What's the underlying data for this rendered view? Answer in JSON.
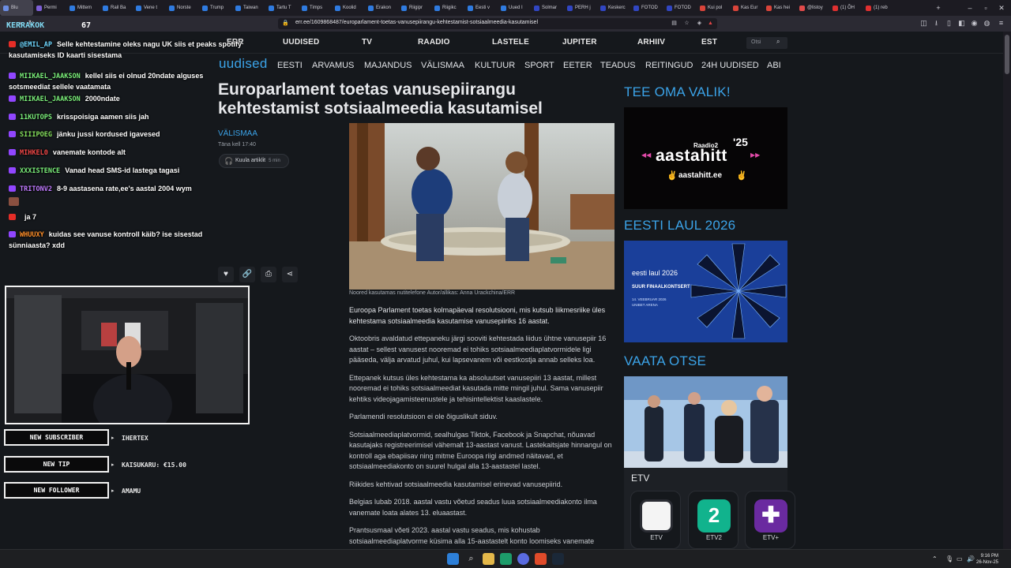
{
  "browser": {
    "tabs": [
      {
        "label": "Blu",
        "color": "#6b8de3",
        "active": true
      },
      {
        "label": "Permi",
        "color": "#7d5fd6"
      },
      {
        "label": "Mittem",
        "color": "#2f7be0"
      },
      {
        "label": "Rail Ba",
        "color": "#2f7be0"
      },
      {
        "label": "Vene t",
        "color": "#2f7be0"
      },
      {
        "label": "Norste",
        "color": "#2f7be0"
      },
      {
        "label": "Trump",
        "color": "#2f7be0"
      },
      {
        "label": "Taiwan",
        "color": "#2f7be0"
      },
      {
        "label": "Tartu T",
        "color": "#2f7be0"
      },
      {
        "label": "Timps",
        "color": "#2f7be0"
      },
      {
        "label": "Koolid",
        "color": "#2f7be0"
      },
      {
        "label": "Erakon",
        "color": "#2f7be0"
      },
      {
        "label": "Riigipr",
        "color": "#2f7be0"
      },
      {
        "label": "Riigikc",
        "color": "#2f7be0"
      },
      {
        "label": "Eesti v",
        "color": "#2f7be0"
      },
      {
        "label": "Uued I",
        "color": "#2f7be0"
      },
      {
        "label": "Solmar",
        "color": "#3146c2"
      },
      {
        "label": "PERH j",
        "color": "#3146c2"
      },
      {
        "label": "Keskerc",
        "color": "#3146c2"
      },
      {
        "label": "FOTOD",
        "color": "#3146c2"
      },
      {
        "label": "FOTOD",
        "color": "#3146c2"
      },
      {
        "label": "Kui pol",
        "color": "#d9443a"
      },
      {
        "label": "Kas Eur",
        "color": "#d9443a"
      },
      {
        "label": "Kas hei",
        "color": "#d9443a"
      },
      {
        "label": "@listoy",
        "color": "#e04a4a"
      },
      {
        "label": "(1) ÕH",
        "color": "#e03030"
      },
      {
        "label": "(1) reb",
        "color": "#e03030"
      }
    ],
    "url": "err.ee/1609868487/europarlament-toetas-vanusepiirangu-kehtestamist-sotsiaalmeedia-kasutamisel"
  },
  "site": {
    "top_nav": [
      "ERR",
      "UUDISED",
      "TV",
      "RAADIO",
      "LASTELE",
      "JUPITER",
      "ARHIIV",
      "EST"
    ],
    "search_placeholder": "Otsi",
    "logo": "uudised",
    "sections": [
      "EESTI",
      "ARVAMUS",
      "MAJANDUS",
      "VÄLISMAA",
      "KULTUUR",
      "SPORT",
      "EETER",
      "TEADUS",
      "REITINGUD",
      "24H UUDISED",
      "ABI"
    ]
  },
  "article": {
    "headline": "Europarlament toetas vanusepiirangu kehtestamist sotsiaalmeedia kasutamisel",
    "category": "VÄLISMAA",
    "time": "Täna kell 17:40",
    "listen_label": "Kuula artiklit",
    "listen_duration": "5 min",
    "caption": "Noored kasutamas nutitelefone Autor/allikas: Anna Urackchina/ERR",
    "paragraphs": [
      "Euroopa Parlament toetas kolmapäeval resolutsiooni, mis kutsub liikmesriike üles kehtestama sotsiaalmeedia kasutamise vanusepiiriks 16 aastat.",
      "Oktoobris avaldatud ettepaneku järgi sooviti kehtestada liidus ühtne vanusepiir 16 aastat – sellest vanusest nooremad ei tohiks sotsiaalmeediaplatvormidele ligi pääseda, välja arvatud juhul, kui lapsevanem või eestkostja annab selleks loa.",
      "Ettepanek kutsus üles kehtestama ka absoluutset vanusepiiri 13 aastat, millest nooremad ei tohiks sotsiaalmeediat kasutada mitte mingil juhul. Sama vanusepiir kehtiks videojagamisteenustele ja tehisintellektist kaaslastele.",
      "Parlamendi resolutsioon ei ole õiguslikult siduv.",
      "Sotsiaalmeediaplatvormid, sealhulgas Tiktok, Facebook ja Snapchat, nõuavad kasutajaks registreerimisel vähemalt 13-aastast vanust. Lastekaitsjate hinnangul on kontroll aga ebapiisav ning mitme Euroopa riigi andmed näitavad, et sotsiaalmeediakonto on suurel hulgal alla 13-aastastel lastel.",
      "Riikides kehtivad sotsiaalmeedia kasutamisel erinevad vanusepiirid.",
      "Belgias lubab 2018. aastal vastu võetud seadus luua sotsiaalmeediakonto ilma vanemate loata alates 13. eluaastast.",
      "Prantsusmaal võeti 2023. aastal vastu seadus, mis kohustab sotsiaalmeediaplatvorme küsima alla 15-aastastelt konto loomiseks vanemate"
    ]
  },
  "sidebar": {
    "tee_title": "TEE OMA VALIK!",
    "aastahitt_brand": "Raadio2",
    "aastahitt_title": "aastahitt",
    "aastahitt_year": "'25",
    "aastahitt_url": "aastahitt.ee",
    "eesti_laul_title": "EESTI LAUL 2026",
    "eesti_laul_logo": "eesti laul 2026",
    "eesti_laul_event": "SUUR FINAALKONTSERT",
    "eesti_laul_date": "14. VEEBRUAR 2026",
    "eesti_laul_venue": "UNIBET ARENA",
    "vaata_title": "VAATA OTSE",
    "etv_label": "ETV",
    "channels": [
      "ETV",
      "ETV2",
      "ETV+"
    ]
  },
  "overlay": {
    "streamer": "KERRAKOK",
    "viewers": "67",
    "chat": [
      {
        "user": "@EMIL_AP",
        "color": "#6fd7ff",
        "platform": "youtube",
        "text": "Selle kehtestamine oleks nagu UK siis et peaks spotify kasutamiseks ID kaarti sisestama"
      },
      {
        "user": "MIIKAEL_JAAKSON",
        "color": "#7cf07c",
        "platform": "twitch",
        "text": "kellel siis ei olnud 20ndate alguses sotsmeediat sellele vaatamata"
      },
      {
        "user": "MIIKAEL_JAAKSON",
        "color": "#7cf07c",
        "platform": "twitch",
        "text": "2000ndate"
      },
      {
        "user": "11KUTOPS",
        "color": "#7cf07c",
        "platform": "twitch",
        "text": "krisspoisiga aamen siis jah"
      },
      {
        "user": "SIIIPOEG",
        "color": "#86e05e",
        "platform": "twitch",
        "text": "jänku jussi kordused igavesed"
      },
      {
        "user": "MIHKEL0",
        "color": "#f04848",
        "platform": "twitch",
        "text": "vanemate kontode alt"
      },
      {
        "user": "XXXISTENCE",
        "color": "#7cf07c",
        "platform": "twitch",
        "text": "Vanad head SMS-id lastega tagasi"
      },
      {
        "user": "TRITONV2",
        "color": "#c07bff",
        "platform": "twitch",
        "text": "8-9 aastasena rate,ee's aastal 2004 wym"
      },
      {
        "user": "",
        "color": "#3a3af0",
        "platform": "youtube",
        "text": "ja 7"
      },
      {
        "user": "WHUUXY",
        "color": "#ff8f2a",
        "platform": "twitch",
        "text": "kuidas see vanuse kontroll käib? ise sisestad sünniaasta? xdd"
      }
    ],
    "alerts": [
      {
        "label": "NEW SUBSCRIBER",
        "value": "IHERTEX"
      },
      {
        "label": "NEW TIP",
        "value": "KAISUKARU: €15.00"
      },
      {
        "label": "NEW FOLLOWER",
        "value": "AMAMU"
      }
    ]
  },
  "taskbar": {
    "time": "9:16 PM",
    "date": "26-Nov-25"
  }
}
